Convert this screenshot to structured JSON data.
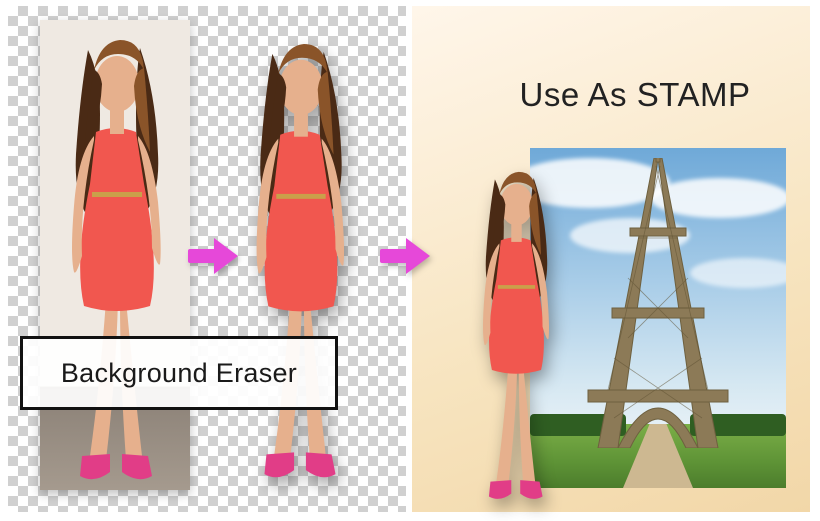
{
  "labels": {
    "feature_title": "Background Eraser",
    "stamp_headline": "Use As STAMP"
  },
  "icons": {
    "arrow": "arrow-right-icon"
  },
  "colors": {
    "arrow": "#e648d9",
    "dress": "#f1574f",
    "skin": "#e6b08d",
    "hair_dark": "#4a2a15",
    "hair_light": "#8a5429",
    "shoes": "#e13d87",
    "tower": "#8c7a57"
  }
}
